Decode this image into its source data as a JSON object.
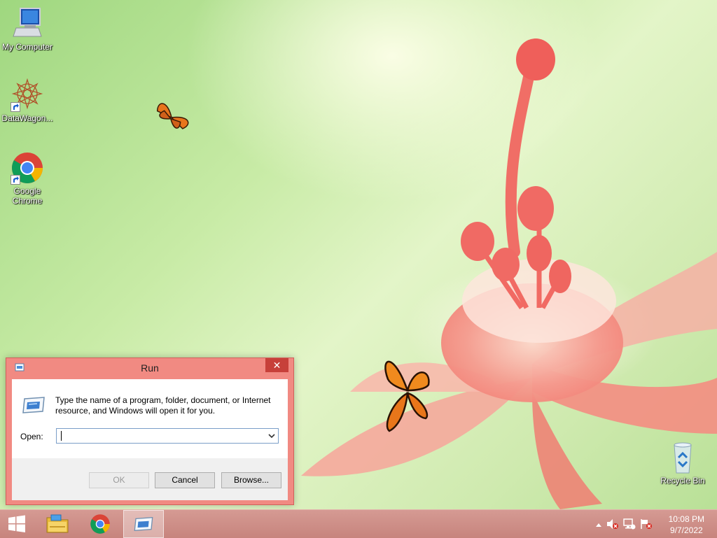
{
  "desktop": {
    "icons": [
      {
        "label": "My Computer",
        "icon": "computer-icon"
      },
      {
        "label": "DataWagon...",
        "icon": "datawagon-icon"
      },
      {
        "label": "Google Chrome",
        "icon": "chrome-icon"
      },
      {
        "label": "Recycle Bin",
        "icon": "recycle-bin-icon"
      }
    ]
  },
  "run_dialog": {
    "title": "Run",
    "close_label": "✕",
    "description": "Type the name of a program, folder, document, or Internet resource, and Windows will open it for you.",
    "open_label": "Open:",
    "open_value": "",
    "buttons": {
      "ok": "OK",
      "cancel": "Cancel",
      "browse": "Browse..."
    }
  },
  "taskbar": {
    "pinned": [
      "start-icon",
      "file-explorer-icon",
      "chrome-icon",
      "run-icon"
    ],
    "tray_icons": [
      "show-hidden-icons-chevron",
      "volume-muted-icon",
      "network-icon",
      "action-center-flag-icon"
    ],
    "time": "10:08 PM",
    "date": "9/7/2022"
  },
  "colors": {
    "dialog_frame": "#f18a82",
    "close_button": "#c7403a",
    "taskbar": "#c7847d"
  }
}
